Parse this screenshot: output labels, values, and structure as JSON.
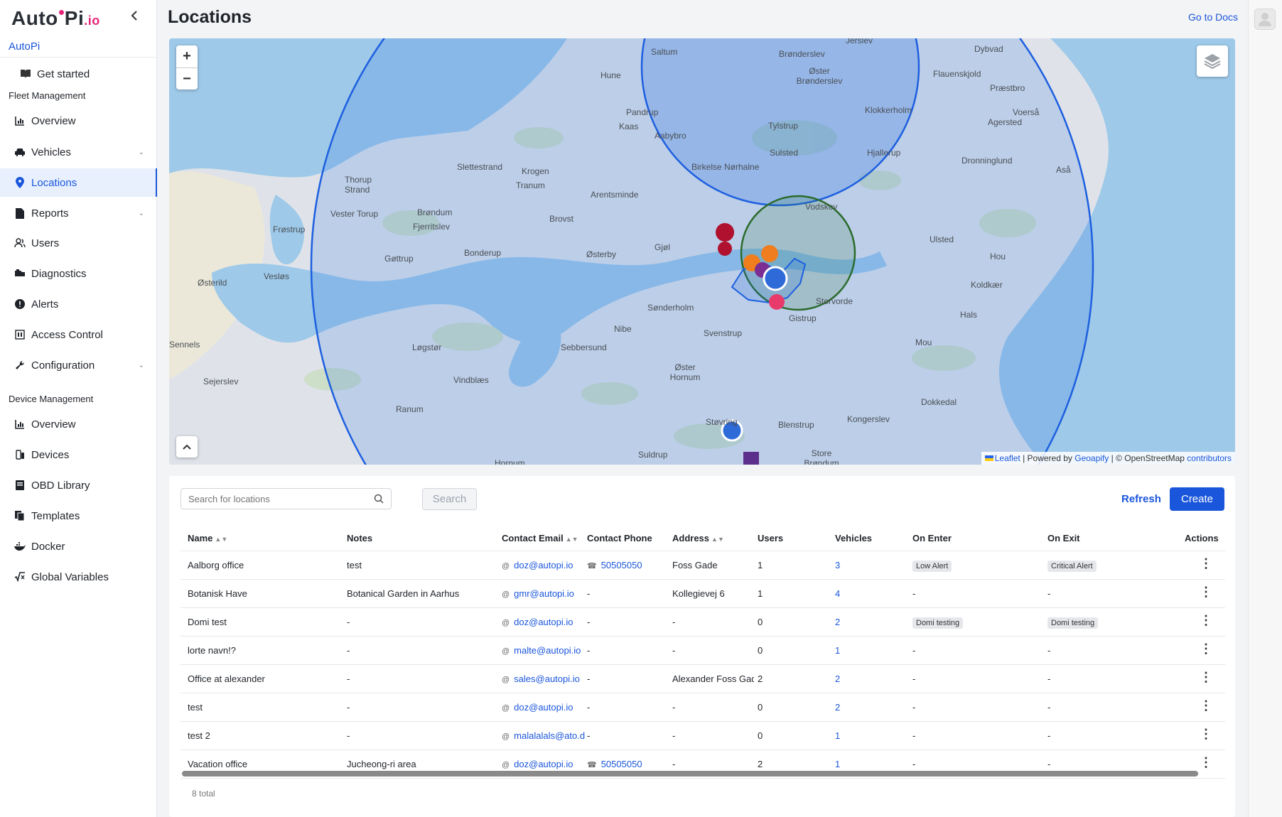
{
  "brand": {
    "logo_main": "Aut",
    "logo_o": "o",
    "logo_pi": "Pi",
    "logo_io": ".io",
    "org": "AutoPi"
  },
  "sidebar": {
    "get_started": "Get started",
    "fleet_heading": "Fleet Management",
    "fleet_items": [
      "Overview",
      "Vehicles",
      "Locations",
      "Reports",
      "Users",
      "Diagnostics",
      "Alerts",
      "Access Control",
      "Configuration"
    ],
    "device_heading": "Device Management",
    "device_items": [
      "Overview",
      "Devices",
      "OBD Library",
      "Templates",
      "Docker",
      "Global Variables"
    ]
  },
  "page": {
    "title": "Locations",
    "docs_link": "Go to Docs"
  },
  "map": {
    "zoom_in": "+",
    "zoom_out": "−",
    "attribution": {
      "leaflet": "Leaflet",
      "powered": " | Powered by ",
      "geoapify": "Geoapify",
      "osm": " | © OpenStreetMap ",
      "contributors": "contributors"
    },
    "places": [
      "Saltum",
      "Jerslev",
      "Dybvad",
      "Brønderslev",
      "Øster Brønderslev",
      "Flauenskjold",
      "Hune",
      "Præstbro",
      "Pandrup",
      "Klokkerholm",
      "Voerså",
      "Kaas",
      "Tylstrup",
      "Agersted",
      "Aabybro",
      "Sulsted",
      "Hjallerup",
      "Dronninglund",
      "Slettestrand",
      "Krogen",
      "Birkelse Nørhalne",
      "Tranum",
      "Thorup Strand",
      "Arentsminde",
      "Aså",
      "Vodskov",
      "Brøndum",
      "Vester Torup",
      "Brovst",
      "Fjerritslev",
      "Frøstrup",
      "Ulsted",
      "Gjøl",
      "Bonderup",
      "Østerby",
      "Gøttrup",
      "Hou",
      "Vesløs",
      "Østerild",
      "Koldkær",
      "Sønderholm",
      "Storvorde",
      "Hals",
      "Gistrup",
      "Nibe",
      "Svenstrup",
      "Mou",
      "Sennels",
      "Løgstør",
      "Sebbersund",
      "Øster Hornum",
      "Sejerslev",
      "Vindblæs",
      "Dokkedal",
      "Ranum",
      "Kongerslev",
      "Blenstrup",
      "Støvring",
      "Suldrup",
      "Store Brøndum",
      "Hornum"
    ]
  },
  "toolbar": {
    "search_placeholder": "Search for locations",
    "search_button": "Search",
    "refresh": "Refresh",
    "create": "Create"
  },
  "table": {
    "columns": [
      "Name",
      "Notes",
      "Contact Email",
      "Contact Phone",
      "Address",
      "Users",
      "Vehicles",
      "On Enter",
      "On Exit",
      "Actions"
    ],
    "rows": [
      {
        "name": "Aalborg office",
        "notes": "test",
        "email": "doz@autopi.io",
        "phone": "50505050",
        "address": "Foss Gade",
        "users": "1",
        "vehicles": "3",
        "on_enter": "Low Alert",
        "on_exit": "Critical Alert"
      },
      {
        "name": "Botanisk Have",
        "notes": "Botanical Garden in Aarhus",
        "email": "gmr@autopi.io",
        "phone": "-",
        "address": "Kollegievej 6",
        "users": "1",
        "vehicles": "4",
        "on_enter": "-",
        "on_exit": "-"
      },
      {
        "name": "Domi test",
        "notes": "-",
        "email": "doz@autopi.io",
        "phone": "-",
        "address": "-",
        "users": "0",
        "vehicles": "2",
        "on_enter": "Domi testing",
        "on_exit": "Domi testing"
      },
      {
        "name": "lorte navn!?",
        "notes": "-",
        "email": "malte@autopi.io",
        "phone": "-",
        "address": "-",
        "users": "0",
        "vehicles": "1",
        "on_enter": "-",
        "on_exit": "-"
      },
      {
        "name": "Office at alexander",
        "notes": "-",
        "email": "sales@autopi.io",
        "phone": "-",
        "address": "Alexander Foss Gad",
        "users": "2",
        "vehicles": "2",
        "on_enter": "-",
        "on_exit": "-"
      },
      {
        "name": "test",
        "notes": "-",
        "email": "doz@autopi.io",
        "phone": "-",
        "address": "-",
        "users": "0",
        "vehicles": "2",
        "on_enter": "-",
        "on_exit": "-"
      },
      {
        "name": "test 2",
        "notes": "-",
        "email": "malalalals@ato.d",
        "phone": "-",
        "address": "-",
        "users": "0",
        "vehicles": "1",
        "on_enter": "-",
        "on_exit": "-"
      },
      {
        "name": "Vacation office",
        "notes": "Jucheong-ri area",
        "email": "doz@autopi.io",
        "phone": "50505050",
        "address": "-",
        "users": "2",
        "vehicles": "1",
        "on_enter": "-",
        "on_exit": "-"
      }
    ],
    "total": "8 total"
  }
}
